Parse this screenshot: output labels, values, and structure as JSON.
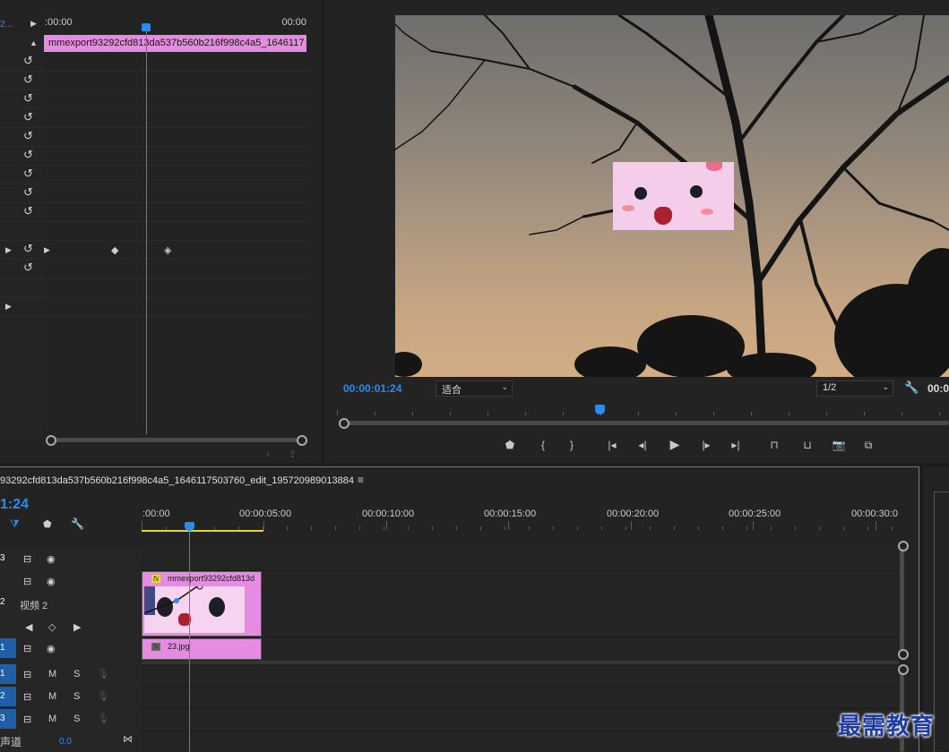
{
  "effect_controls": {
    "ruler_start": ":00:00",
    "ruler_end": "00:00",
    "clip_label": "mmexport93292cfd813da537b560b216f998c4a5_1646117",
    "tab_fragment": "2..."
  },
  "program_monitor": {
    "timecode": "00:00:01:24",
    "zoom_select": "适合",
    "resolution_select": "1/2",
    "timecode_right": "00:0"
  },
  "timeline": {
    "sequence_name": "93292cfd813da537b560b216f998c4a5_1646117503760_edit_195720989013884",
    "timecode": "1:24",
    "ruler_labels": [
      ":00:00",
      "00:00:05:00",
      "00:00:10:00",
      "00:00:15:00",
      "00:00:20:00",
      "00:00:25:00",
      "00:00:30:0"
    ],
    "tracks": {
      "v3": "3",
      "v2": "2",
      "v2_name": "视频 2",
      "v1": "1",
      "a1": "1",
      "a2": "2",
      "a3": "3",
      "mute": "M",
      "solo": "S",
      "master": "声道",
      "master_value": "0.0"
    },
    "clips": {
      "v2_clip": "mmexport93292cfd813d",
      "v1_clip": "23.jpg",
      "fx_badge": "fx"
    }
  },
  "watermark": "最需教育",
  "colors": {
    "accent_blue": "#2d8ceb",
    "clip_pink": "#e58be0",
    "work_area_yellow": "#e5d630"
  }
}
